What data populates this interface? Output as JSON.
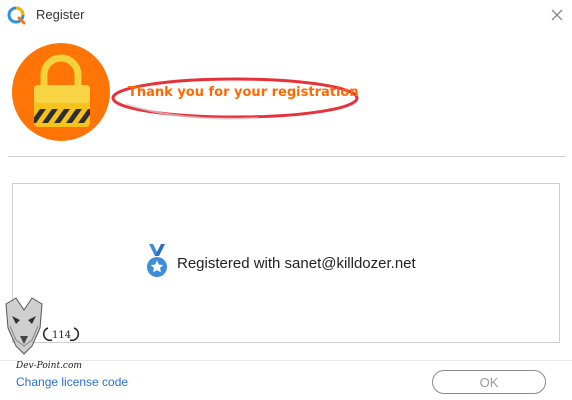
{
  "window": {
    "title": "Register"
  },
  "header": {
    "thanks_message": "Thank you for your registration"
  },
  "info": {
    "registered_text": "Registered with sanet@killdozer.net"
  },
  "watermark": {
    "site": "Dev-Point.com",
    "logo_text": "114"
  },
  "footer": {
    "change_license_label": "Change license code",
    "ok_label": "OK"
  },
  "colors": {
    "accent_orange": "#ff7406",
    "highlight_red": "#e8313a",
    "link_blue": "#2a6fc9",
    "medal_blue": "#3d8ed6"
  },
  "icons": {
    "app": "app-logo-icon",
    "close": "close-icon",
    "lock": "padlock-icon",
    "medal": "medal-icon"
  }
}
